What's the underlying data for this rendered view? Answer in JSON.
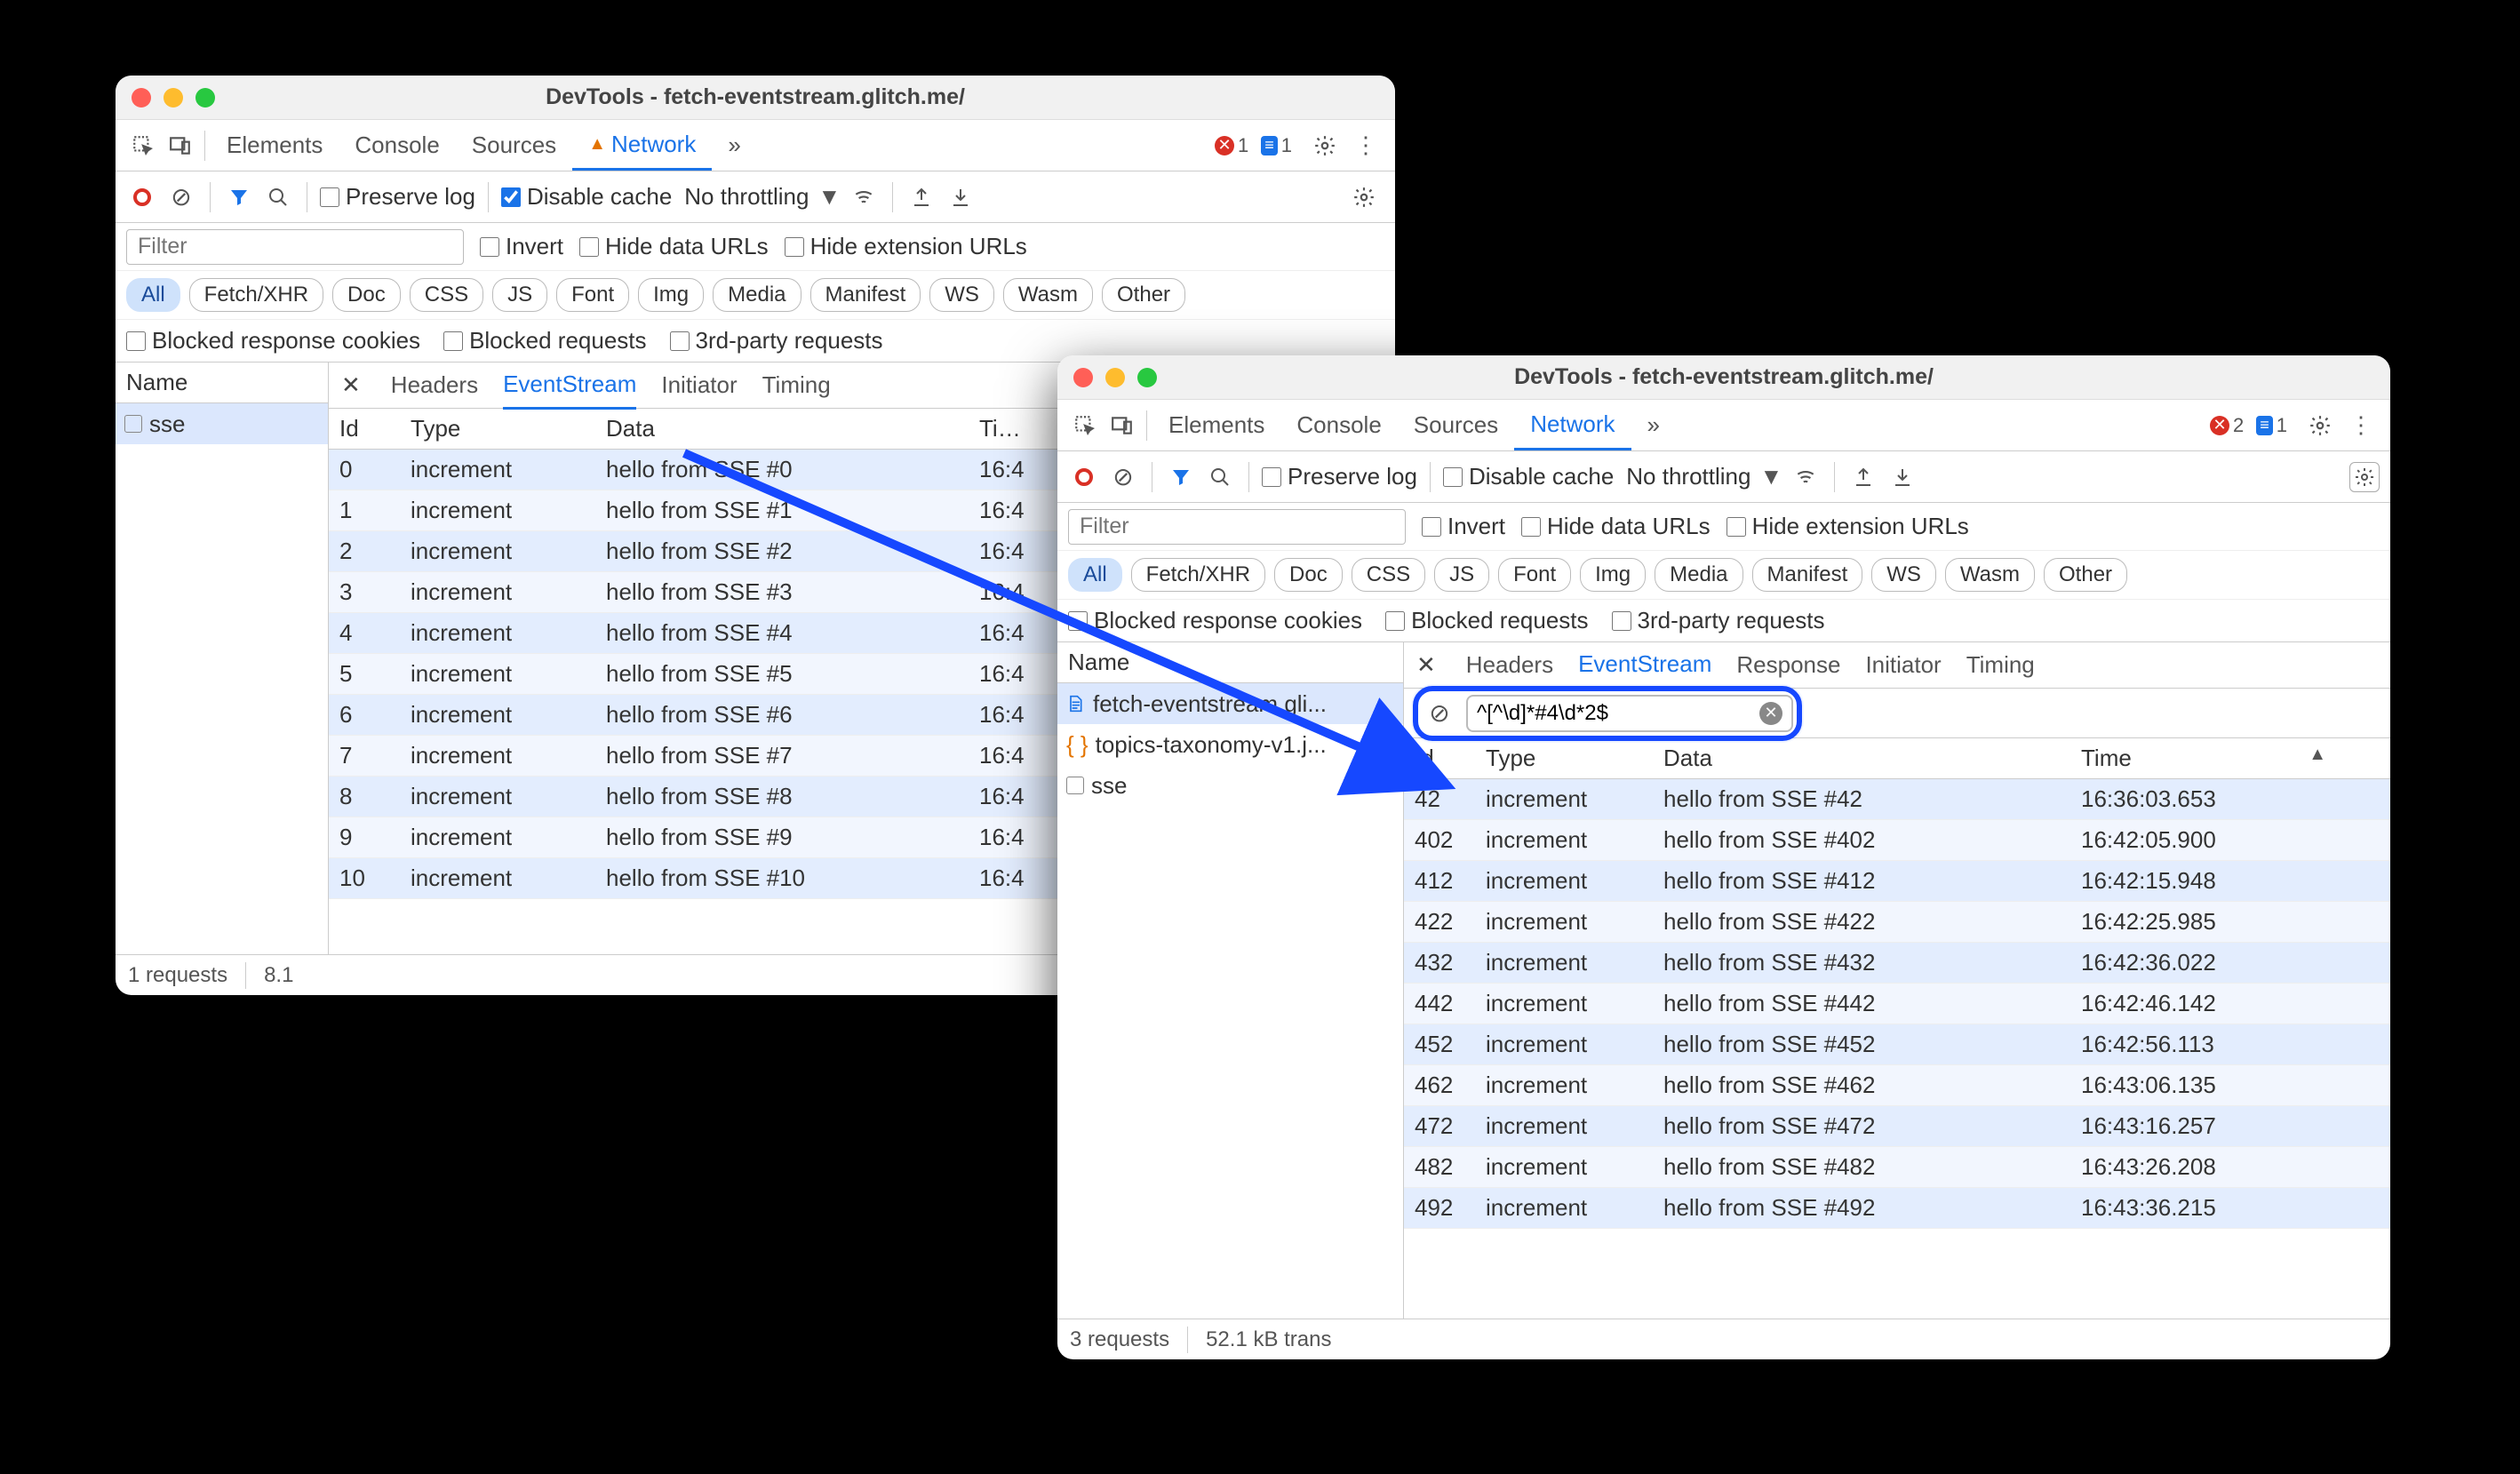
{
  "left": {
    "title": "DevTools - fetch-eventstream.glitch.me/",
    "tabs": [
      "Elements",
      "Console",
      "Sources",
      "Network"
    ],
    "active_tab": "Network",
    "errors": 1,
    "infos": 1,
    "toolbar": {
      "preserve_log": "Preserve log",
      "preserve_log_checked": false,
      "disable_cache": "Disable cache",
      "disable_cache_checked": true,
      "throttling": "No throttling"
    },
    "filter_placeholder": "Filter",
    "filter_opts": {
      "invert": "Invert",
      "hide_data": "Hide data URLs",
      "hide_ext": "Hide extension URLs"
    },
    "chips": [
      "All",
      "Fetch/XHR",
      "Doc",
      "CSS",
      "JS",
      "Font",
      "Img",
      "Media",
      "Manifest",
      "WS",
      "Wasm",
      "Other"
    ],
    "active_chip": "All",
    "checks": {
      "blocked_cookies": "Blocked response cookies",
      "blocked_req": "Blocked requests",
      "third_party": "3rd-party requests"
    },
    "name_header": "Name",
    "requests": [
      {
        "name": "sse",
        "sel": true
      }
    ],
    "dtabs": [
      "Headers",
      "EventStream",
      "Initiator",
      "Timing"
    ],
    "active_dtab": "EventStream",
    "table": {
      "headers": [
        "Id",
        "Type",
        "Data",
        "Time"
      ],
      "rows": [
        {
          "id": "0",
          "type": "increment",
          "data": "hello from SSE #0",
          "time": "16:4"
        },
        {
          "id": "1",
          "type": "increment",
          "data": "hello from SSE #1",
          "time": "16:4"
        },
        {
          "id": "2",
          "type": "increment",
          "data": "hello from SSE #2",
          "time": "16:4"
        },
        {
          "id": "3",
          "type": "increment",
          "data": "hello from SSE #3",
          "time": "16:4"
        },
        {
          "id": "4",
          "type": "increment",
          "data": "hello from SSE #4",
          "time": "16:4"
        },
        {
          "id": "5",
          "type": "increment",
          "data": "hello from SSE #5",
          "time": "16:4"
        },
        {
          "id": "6",
          "type": "increment",
          "data": "hello from SSE #6",
          "time": "16:4"
        },
        {
          "id": "7",
          "type": "increment",
          "data": "hello from SSE #7",
          "time": "16:4"
        },
        {
          "id": "8",
          "type": "increment",
          "data": "hello from SSE #8",
          "time": "16:4"
        },
        {
          "id": "9",
          "type": "increment",
          "data": "hello from SSE #9",
          "time": "16:4"
        },
        {
          "id": "10",
          "type": "increment",
          "data": "hello from SSE #10",
          "time": "16:4"
        }
      ]
    },
    "footer": {
      "requests": "1 requests",
      "size": "8.1"
    }
  },
  "right": {
    "title": "DevTools - fetch-eventstream.glitch.me/",
    "tabs": [
      "Elements",
      "Console",
      "Sources",
      "Network"
    ],
    "active_tab": "Network",
    "errors": 2,
    "infos": 1,
    "toolbar": {
      "preserve_log": "Preserve log",
      "preserve_log_checked": false,
      "disable_cache": "Disable cache",
      "disable_cache_checked": false,
      "throttling": "No throttling"
    },
    "filter_placeholder": "Filter",
    "filter_opts": {
      "invert": "Invert",
      "hide_data": "Hide data URLs",
      "hide_ext": "Hide extension URLs"
    },
    "chips": [
      "All",
      "Fetch/XHR",
      "Doc",
      "CSS",
      "JS",
      "Font",
      "Img",
      "Media",
      "Manifest",
      "WS",
      "Wasm",
      "Other"
    ],
    "active_chip": "All",
    "checks": {
      "blocked_cookies": "Blocked response cookies",
      "blocked_req": "Blocked requests",
      "third_party": "3rd-party requests"
    },
    "name_header": "Name",
    "requests": [
      {
        "name": "fetch-eventstream.gli...",
        "icon": "doc",
        "sel": true
      },
      {
        "name": "topics-taxonomy-v1.j...",
        "icon": "js"
      },
      {
        "name": "sse",
        "icon": "box"
      }
    ],
    "dtabs": [
      "Headers",
      "EventStream",
      "Response",
      "Initiator",
      "Timing"
    ],
    "active_dtab": "EventStream",
    "regex": "^[^\\d]*#4\\d*2$",
    "table": {
      "headers": [
        "Id",
        "Type",
        "Data",
        "Time"
      ],
      "rows": [
        {
          "id": "42",
          "type": "increment",
          "data": "hello from SSE #42",
          "time": "16:36:03.653"
        },
        {
          "id": "402",
          "type": "increment",
          "data": "hello from SSE #402",
          "time": "16:42:05.900"
        },
        {
          "id": "412",
          "type": "increment",
          "data": "hello from SSE #412",
          "time": "16:42:15.948"
        },
        {
          "id": "422",
          "type": "increment",
          "data": "hello from SSE #422",
          "time": "16:42:25.985"
        },
        {
          "id": "432",
          "type": "increment",
          "data": "hello from SSE #432",
          "time": "16:42:36.022"
        },
        {
          "id": "442",
          "type": "increment",
          "data": "hello from SSE #442",
          "time": "16:42:46.142"
        },
        {
          "id": "452",
          "type": "increment",
          "data": "hello from SSE #452",
          "time": "16:42:56.113"
        },
        {
          "id": "462",
          "type": "increment",
          "data": "hello from SSE #462",
          "time": "16:43:06.135"
        },
        {
          "id": "472",
          "type": "increment",
          "data": "hello from SSE #472",
          "time": "16:43:16.257"
        },
        {
          "id": "482",
          "type": "increment",
          "data": "hello from SSE #482",
          "time": "16:43:26.208"
        },
        {
          "id": "492",
          "type": "increment",
          "data": "hello from SSE #492",
          "time": "16:43:36.215"
        }
      ]
    },
    "footer": {
      "requests": "3 requests",
      "size": "52.1 kB trans"
    }
  }
}
